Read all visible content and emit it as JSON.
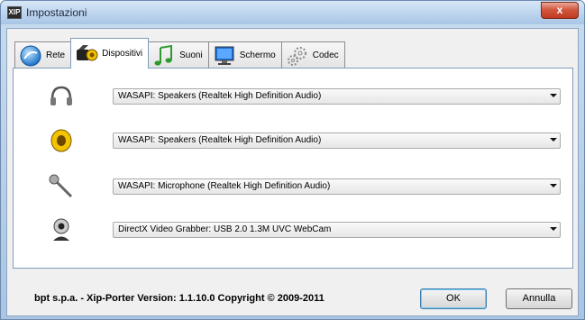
{
  "window": {
    "title": "Impostazioni",
    "app_icon_text": "XIP",
    "close_glyph": "x"
  },
  "tabs": [
    {
      "label": "Rete",
      "icon": "network-globe-icon"
    },
    {
      "label": "Dispositivi",
      "icon": "devices-icon",
      "active": true
    },
    {
      "label": "Suoni",
      "icon": "music-note-icon"
    },
    {
      "label": "Schermo",
      "icon": "monitor-icon"
    },
    {
      "label": "Codec",
      "icon": "gears-icon"
    }
  ],
  "devices": [
    {
      "icon": "headphones-icon",
      "selected": "WASAPI: Speakers (Realtek High Definition Audio)"
    },
    {
      "icon": "speaker-icon",
      "selected": "WASAPI: Speakers (Realtek High Definition Audio)"
    },
    {
      "icon": "microphone-icon",
      "selected": "WASAPI: Microphone (Realtek High Definition Audio)"
    },
    {
      "icon": "webcam-icon",
      "selected": "DirectX Video Grabber: USB 2.0 1.3M UVC WebCam"
    }
  ],
  "footer": {
    "info": "bpt s.p.a. - Xip-Porter   Version: 1.1.10.0   Copyright © 2009-2011",
    "ok_label": "OK",
    "cancel_label": "Annulla"
  }
}
